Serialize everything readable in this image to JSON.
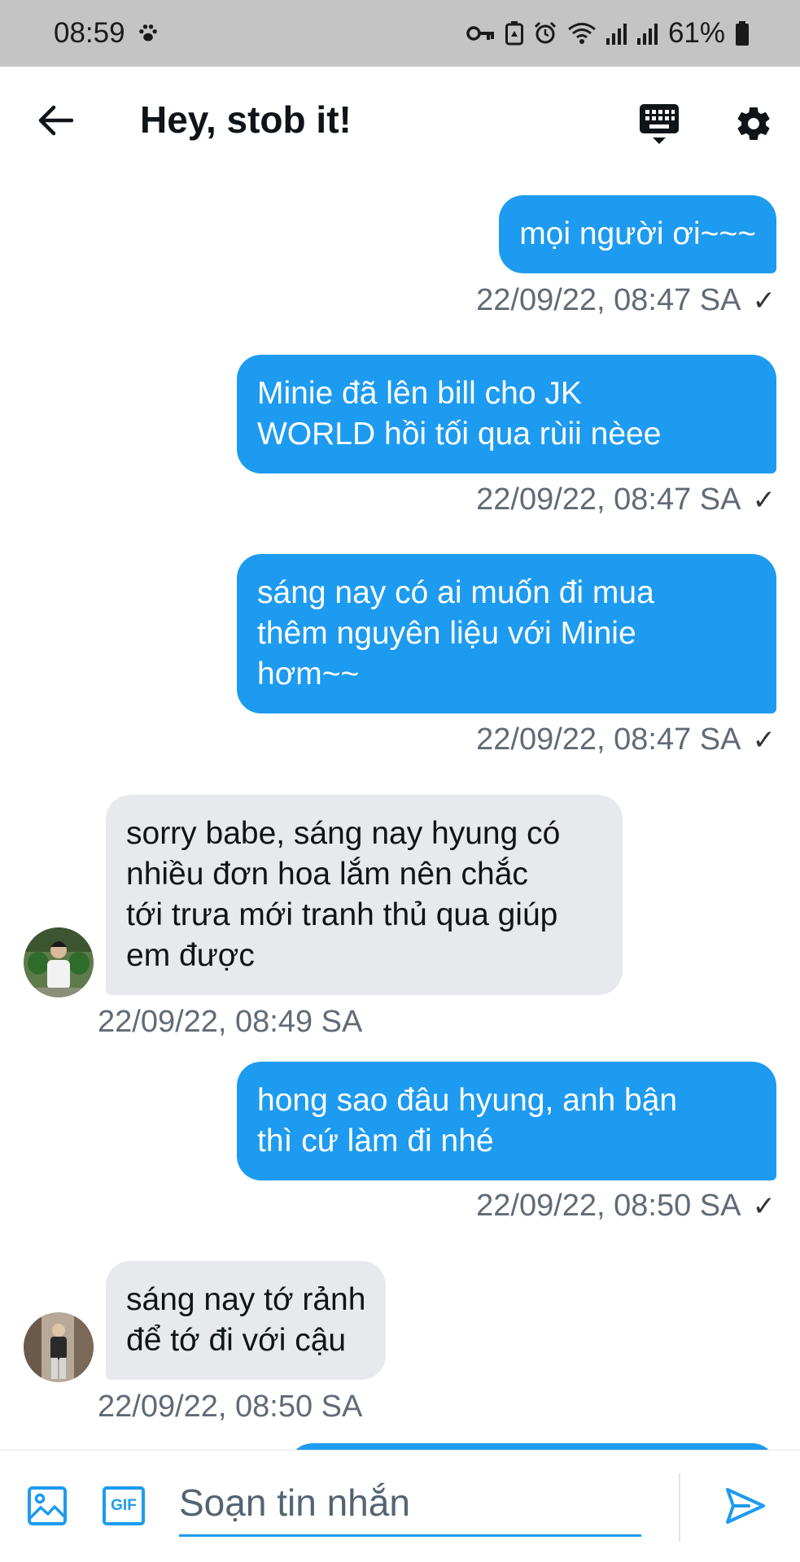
{
  "status_bar": {
    "time": "08:59",
    "battery": "61%"
  },
  "header": {
    "title": "Hey, stob it!"
  },
  "messages": [
    {
      "type": "sent",
      "text": "mọi người ơi~~~",
      "time": "22/09/22, 08:47 SA",
      "check": "✓"
    },
    {
      "type": "sent",
      "text": "Minie đã lên bill cho JK\nWORLD hồi tối qua rùii nèee",
      "time": "22/09/22, 08:47 SA",
      "check": "✓"
    },
    {
      "type": "sent",
      "text": "sáng nay có ai muốn đi mua\nthêm nguyên liệu với Minie\nhơm~~",
      "time": "22/09/22, 08:47 SA",
      "check": "✓"
    },
    {
      "type": "received",
      "text": "sorry babe, sáng nay hyung có\nnhiều đơn hoa lắm nên chắc\ntới trưa mới tranh thủ qua giúp\nem được",
      "time": "22/09/22, 08:49 SA"
    },
    {
      "type": "sent",
      "text": "hong sao đâu hyung, anh bận\nthì cứ làm đi nhé",
      "time": "22/09/22, 08:50 SA",
      "check": "✓"
    },
    {
      "type": "received",
      "text": "sáng nay tớ rảnh\nđể tớ đi với cậu",
      "time": "22/09/22, 08:50 SA"
    }
  ],
  "composer": {
    "placeholder": "Soạn tin nhắn",
    "gif_label": "GIF"
  },
  "colors": {
    "accent": "#1d9bf0",
    "received_bubble": "#e7e9ec",
    "timestamp": "#606b76",
    "status_bar": "#c4c4c4"
  }
}
